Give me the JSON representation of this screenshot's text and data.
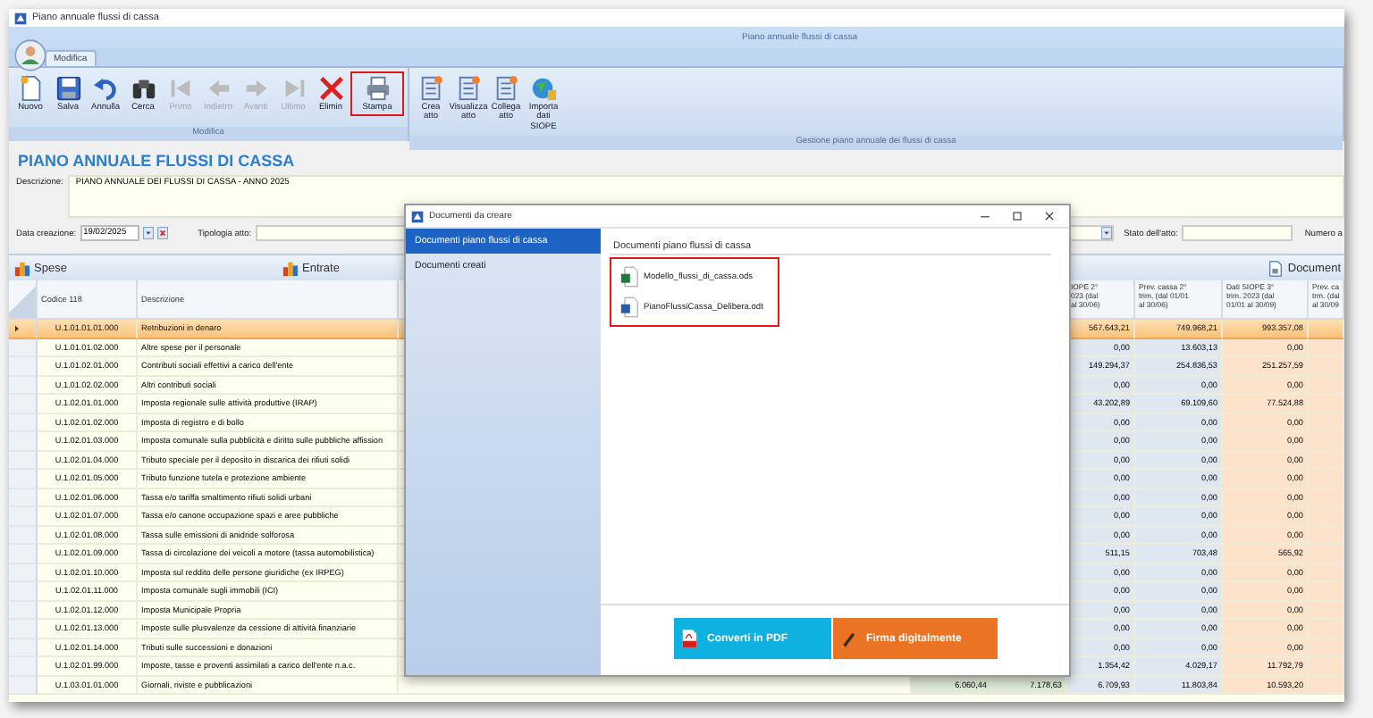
{
  "window": {
    "title": "Piano annuale flussi di cassa"
  },
  "ribbon": {
    "title": "Piano annuale flussi di cassa",
    "tabs": [
      {
        "label": "Modifica",
        "selected": true
      }
    ],
    "groups": [
      {
        "label": "Modifica",
        "buttons": [
          {
            "label": "Nuovo",
            "disabled": false,
            "highlighted": false
          },
          {
            "label": "Salva",
            "disabled": false,
            "highlighted": false
          },
          {
            "label": "Annulla",
            "disabled": false,
            "highlighted": false
          },
          {
            "label": "Cerca",
            "disabled": false,
            "highlighted": false
          },
          {
            "label": "Primo",
            "disabled": true,
            "highlighted": false
          },
          {
            "label": "Indietro",
            "disabled": true,
            "highlighted": false
          },
          {
            "label": "Avanti",
            "disabled": true,
            "highlighted": false
          },
          {
            "label": "Ultimo",
            "disabled": true,
            "highlighted": false
          },
          {
            "label": "Elimin",
            "disabled": false,
            "highlighted": false
          },
          {
            "label": "Stampa",
            "disabled": false,
            "highlighted": true
          }
        ]
      },
      {
        "label": "Gestione piano annuale dei flussi di cassa",
        "buttons": [
          {
            "label": "Crea atto",
            "disabled": false,
            "highlighted": false
          },
          {
            "label": "Visualizza atto",
            "disabled": false,
            "highlighted": false
          },
          {
            "label": "Collega atto",
            "disabled": false,
            "highlighted": false
          },
          {
            "label": "Importa dati SIOPE",
            "disabled": false,
            "highlighted": false
          }
        ]
      }
    ]
  },
  "page_title": "PIANO ANNUALE FLUSSI DI CASSA",
  "form": {
    "description_label": "Descrizione:",
    "description": "PIANO ANNUALE DEI FLUSSI DI CASSA - ANNO 2025",
    "date_label": "Data creazione:",
    "date": "19/02/2025",
    "type_label": "Tipologia atto:",
    "state_label": "Stato dell'atto:",
    "number_label": "Numero a"
  },
  "sections": [
    {
      "label": "Spese"
    },
    {
      "label": "Entrate"
    },
    {
      "label": "Document"
    }
  ],
  "table": {
    "columns": [
      "Codice 118",
      "Descrizione",
      "IOPE 2°\n023 (dal\nal 30/06)",
      "Prev. cassa 2°\ntrim. (dal 01/01\nal 30/06)",
      "Dati SIOPE 3°\ntrim. 2023 (dal\n01/01 al 30/09)",
      "Prev. ca\ntrm. (dal\nal 30/09"
    ],
    "rows": [
      {
        "code": "U.1.01.01.01.000",
        "description": "Retribuzioni in denaro",
        "selected": true,
        "hidden_values": null,
        "values": [
          "567.643,21",
          "749.968,21",
          "993.357,08"
        ]
      },
      {
        "code": "U.1.01.01.02.000",
        "description": "Altre spese per il personale",
        "selected": false,
        "hidden_values": null,
        "values": [
          "0,00",
          "13.603,13",
          "0,00"
        ]
      },
      {
        "code": "U.1.01.02.01.000",
        "description": "Contributi sociali effettivi a carico dell'ente",
        "selected": false,
        "hidden_values": null,
        "values": [
          "149.294,37",
          "254.836,53",
          "251.257,59"
        ]
      },
      {
        "code": "U.1.01.02.02.000",
        "description": "Altri contributi sociali",
        "selected": false,
        "hidden_values": null,
        "values": [
          "0,00",
          "0,00",
          "0,00"
        ]
      },
      {
        "code": "U.1.02.01.01.000",
        "description": "Imposta regionale sulle attività produttive (IRAP)",
        "selected": false,
        "hidden_values": null,
        "values": [
          "43.202,89",
          "69.109,60",
          "77.524,88"
        ]
      },
      {
        "code": "U.1.02.01.02.000",
        "description": "Imposta di registro e di bollo",
        "selected": false,
        "hidden_values": null,
        "values": [
          "0,00",
          "0,00",
          "0,00"
        ]
      },
      {
        "code": "U.1.02.01.03.000",
        "description": "Imposta comunale sulla pubblicità e diritto sulle pubbliche affission",
        "selected": false,
        "hidden_values": null,
        "values": [
          "0,00",
          "0,00",
          "0,00"
        ]
      },
      {
        "code": "U.1.02.01.04.000",
        "description": "Tributo speciale per il deposito in discarica dei rifiuti solidi",
        "selected": false,
        "hidden_values": null,
        "values": [
          "0,00",
          "0,00",
          "0,00"
        ]
      },
      {
        "code": "U.1.02.01.05.000",
        "description": "Tributo funzione tutela e protezione ambiente",
        "selected": false,
        "hidden_values": null,
        "values": [
          "0,00",
          "0,00",
          "0,00"
        ]
      },
      {
        "code": "U.1.02.01.06.000",
        "description": "Tassa e/o tariffa smaltimento rifiuti solidi urbani",
        "selected": false,
        "hidden_values": null,
        "values": [
          "0,00",
          "0,00",
          "0,00"
        ]
      },
      {
        "code": "U.1.02.01.07.000",
        "description": "Tassa e/o canone occupazione spazi e aree pubbliche",
        "selected": false,
        "hidden_values": null,
        "values": [
          "0,00",
          "0,00",
          "0,00"
        ]
      },
      {
        "code": "U.1.02.01.08.000",
        "description": "Tassa sulle emissioni di anidride solforosa",
        "selected": false,
        "hidden_values": null,
        "values": [
          "0,00",
          "0,00",
          "0,00"
        ]
      },
      {
        "code": "U.1.02.01.09.000",
        "description": "Tassa di circolazione dei veicoli a motore (tassa automobilistica)",
        "selected": false,
        "hidden_values": null,
        "values": [
          "511,15",
          "703,48",
          "565,92"
        ]
      },
      {
        "code": "U.1.02.01.10.000",
        "description": "Imposta sul reddito delle persone giuridiche (ex IRPEG)",
        "selected": false,
        "hidden_values": null,
        "values": [
          "0,00",
          "0,00",
          "0,00"
        ]
      },
      {
        "code": "U.1.02.01.11.000",
        "description": "Imposta comunale sugli immobili (ICI)",
        "selected": false,
        "hidden_values": null,
        "values": [
          "0,00",
          "0,00",
          "0,00"
        ]
      },
      {
        "code": "U.1.02.01.12.000",
        "description": "Imposta Municipale Propria",
        "selected": false,
        "hidden_values": null,
        "values": [
          "0,00",
          "0,00",
          "0,00"
        ]
      },
      {
        "code": "U.1.02.01.13.000",
        "description": "Imposte sulle plusvalenze da cessione di attività finanziarie",
        "selected": false,
        "hidden_values": null,
        "values": [
          "0,00",
          "0,00",
          "0,00"
        ]
      },
      {
        "code": "U.1.02.01.14.000",
        "description": "Tributi sulle successioni e donazioni",
        "selected": false,
        "hidden_values": null,
        "values": [
          "0,00",
          "0,00",
          "0,00"
        ]
      },
      {
        "code": "U.1.02.01.99.000",
        "description": "Imposte, tasse e proventi assimilati a carico dell'ente n.a.c.",
        "selected": false,
        "hidden_values": null,
        "values": [
          "1.354,42",
          "4.029,17",
          "11.792,79"
        ]
      },
      {
        "code": "U.1.03.01.01.000",
        "description": "Giornali, riviste e pubblicazioni",
        "selected": false,
        "hidden_values": [
          "6.060,44",
          "7.178,63"
        ],
        "values": [
          "6.709,93",
          "11.803,84",
          "10.593,20"
        ]
      }
    ]
  },
  "dialog": {
    "title": "Documenti da creare",
    "nav": [
      {
        "label": "Documenti piano flussi di cassa",
        "selected": true
      },
      {
        "label": "Documenti creati",
        "selected": false
      }
    ],
    "heading": "Documenti piano flussi di cassa",
    "files_highlighted": true,
    "files": [
      {
        "name": "Modello_flussi_di_cassa.ods",
        "kind": "spreadsheet"
      },
      {
        "name": "PianoFlussiCassa_Delibera.odt",
        "kind": "document"
      }
    ],
    "buttons": [
      {
        "label": "Converti in PDF",
        "kind": "pdf"
      },
      {
        "label": "Firma digitalmente",
        "kind": "sign"
      }
    ]
  }
}
